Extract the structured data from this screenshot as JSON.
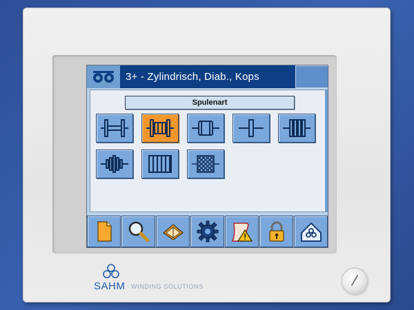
{
  "window": {
    "title": "3+ - Zylindrisch, Diab., Kops"
  },
  "content": {
    "section_label": "Spulenart"
  },
  "spool_types": [
    {
      "icon": "cylindrical-spool-icon",
      "selected": false
    },
    {
      "icon": "cylindrical-disc-spool-icon",
      "selected": true
    },
    {
      "icon": "bobbin-spool-icon",
      "selected": false
    },
    {
      "icon": "cross-shaft-icon",
      "selected": false
    },
    {
      "icon": "multi-disc-spool-icon",
      "selected": false
    },
    {
      "icon": "stepped-spool-icon",
      "selected": false
    },
    {
      "icon": "wire-reel-spool-icon",
      "selected": false
    },
    {
      "icon": "crosswound-package-icon",
      "selected": false
    }
  ],
  "toolbar": [
    {
      "icon": "document-icon"
    },
    {
      "icon": "magnifier-search-icon"
    },
    {
      "icon": "manual-book-icon"
    },
    {
      "icon": "settings-gear-icon"
    },
    {
      "icon": "warning-scroll-icon"
    },
    {
      "icon": "padlock-icon"
    },
    {
      "icon": "home-icon"
    }
  ],
  "brand": {
    "name": "SAHM",
    "tagline": "WINDING SOLUTIONS"
  },
  "colors": {
    "titlebar": "#0e3f84",
    "button": "#7aa8dc",
    "selected": "#f1962b",
    "screen_bg": "#b9d2e8"
  }
}
